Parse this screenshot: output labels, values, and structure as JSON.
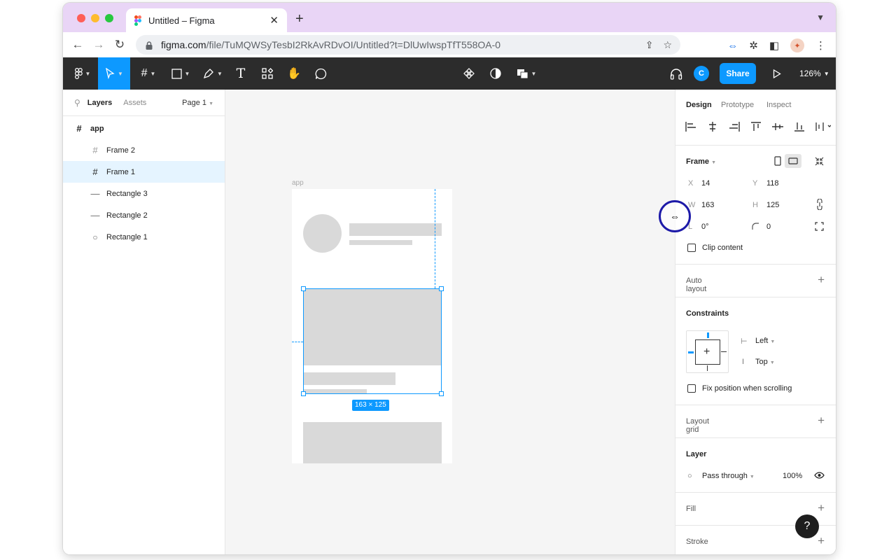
{
  "browser": {
    "tab_title": "Untitled – Figma",
    "url_host": "figma.com",
    "url_path": "/file/TuMQWSyTesbI2RkAvRDvOI/Untitled?t=DlUwIwspTfT558OA-0"
  },
  "toolbar": {
    "share_label": "Share",
    "user_initial": "C",
    "zoom": "126%"
  },
  "left_panel": {
    "tab_layers": "Layers",
    "tab_assets": "Assets",
    "page": "Page 1",
    "layers": [
      {
        "name": "app",
        "icon": "frame-icon",
        "indent": 0,
        "selected": false
      },
      {
        "name": "Frame 2",
        "icon": "frame-icon",
        "indent": 1,
        "selected": false
      },
      {
        "name": "Frame 1",
        "icon": "frame-icon",
        "indent": 1,
        "selected": true
      },
      {
        "name": "Rectangle 3",
        "icon": "line-icon",
        "indent": 1,
        "selected": false
      },
      {
        "name": "Rectangle 2",
        "icon": "line-icon",
        "indent": 1,
        "selected": false
      },
      {
        "name": "Rectangle 1",
        "icon": "ellipse-icon",
        "indent": 1,
        "selected": false
      }
    ]
  },
  "canvas": {
    "frame_label": "app",
    "size_badge": "163 × 125"
  },
  "right_panel": {
    "tabs": [
      "Design",
      "Prototype",
      "Inspect"
    ],
    "frame_title": "Frame",
    "x_label": "X",
    "x_value": "14",
    "y_label": "Y",
    "y_value": "118",
    "w_label": "W",
    "w_value": "163",
    "h_label": "H",
    "h_value": "125",
    "rotation_label": "L",
    "rotation_value": "0°",
    "radius_value": "0",
    "clip_content": "Clip content",
    "auto_layout": "Auto layout",
    "constraints": "Constraints",
    "constraint_h": "Left",
    "constraint_v": "Top",
    "fix_position": "Fix position when scrolling",
    "layout_grid": "Layout grid",
    "layer": "Layer",
    "blend_mode": "Pass through",
    "opacity": "100%",
    "fill": "Fill",
    "stroke": "Stroke"
  },
  "help_label": "?",
  "colors": {
    "accent": "#0d99ff",
    "toolbar_bg": "#2c2c2c",
    "tabstrip_bg": "#e9d5f6",
    "selection_bg": "#e5f4ff",
    "placeholder_gray": "#d9d9d9"
  }
}
